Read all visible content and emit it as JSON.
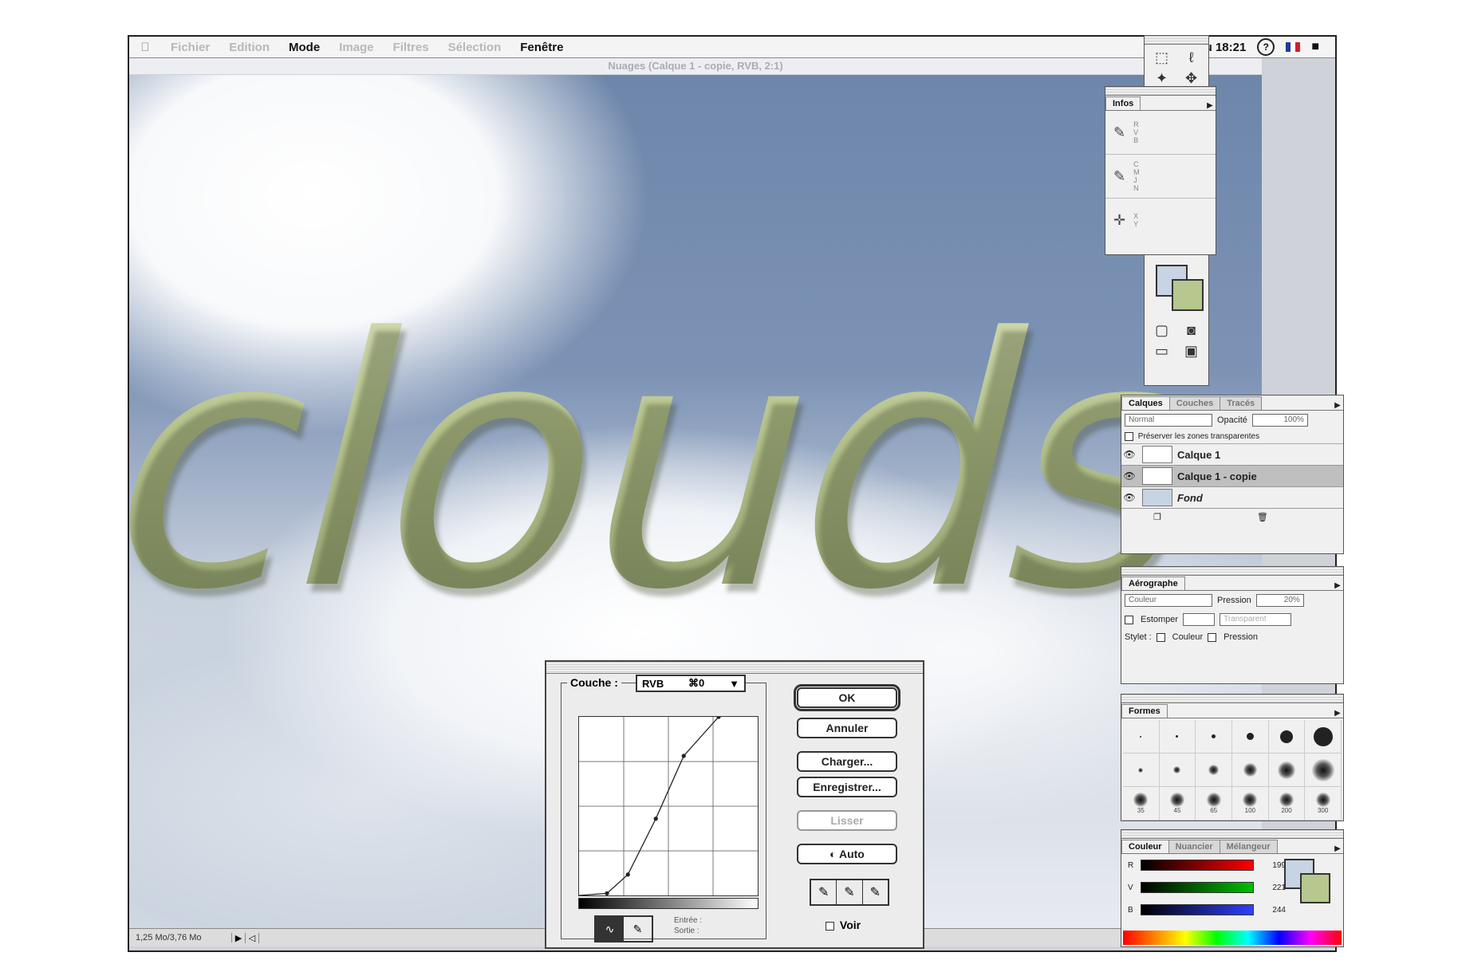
{
  "menubar": {
    "apple": "",
    "items": [
      "Fichier",
      "Edition",
      "Mode",
      "Image",
      "Filtres",
      "Sélection",
      "Fenêtre"
    ],
    "clock": "Jeu 18:21",
    "help": "?"
  },
  "document": {
    "title": "Nuages (Calque 1 - copie, RVB, 2:1)",
    "artwork_text": "clouds"
  },
  "statusbar": {
    "memory": "1,25 Mo/3,76 Mo"
  },
  "infos": {
    "tab": "Infos",
    "rows": [
      {
        "channels": "R\nV\nB"
      },
      {
        "channels": "C\nM\nJ\nN"
      },
      {
        "channels": "X\nY"
      }
    ]
  },
  "calques": {
    "tabs": [
      "Calques",
      "Couches",
      "Tracés"
    ],
    "mode": "Normal",
    "opacity_label": "Opacité",
    "opacity_value": "100%",
    "preserve_label": "Préserver les zones transparentes",
    "layers": [
      {
        "name": "Calque 1"
      },
      {
        "name": "Calque 1 - copie"
      },
      {
        "name": "Fond"
      }
    ]
  },
  "aerographe": {
    "tab": "Aérographe",
    "mode": "Couleur",
    "pressure_label": "Pression",
    "pressure_value": "20%",
    "fade_label": "Estomper",
    "fade_mode": "Transparent",
    "stylet_label": "Stylet :",
    "stylet_color": "Couleur",
    "stylet_pressure": "Pression"
  },
  "formes": {
    "tab": "Formes",
    "sizes": [
      "35",
      "45",
      "65",
      "100",
      "200",
      "300"
    ]
  },
  "couleur": {
    "tabs": [
      "Couleur",
      "Nuancier",
      "Mélangeur"
    ],
    "sliders": [
      {
        "label": "R",
        "value": "199"
      },
      {
        "label": "V",
        "value": "221"
      },
      {
        "label": "B",
        "value": "244"
      }
    ],
    "foreground": "#c6d4e3",
    "background": "#b6c88e"
  },
  "curves": {
    "couche_label": "Couche :",
    "couche_value": "RVB",
    "couche_shortcut": "⌘0",
    "buttons": {
      "ok": "OK",
      "cancel": "Annuler",
      "load": "Charger...",
      "save": "Enregistrer...",
      "smooth": "Lisser",
      "auto": "Auto"
    },
    "input_label": "Entrée :",
    "output_label": "Sortie :",
    "preview_label": "Voir",
    "curve_points": [
      [
        0,
        0
      ],
      [
        40,
        3
      ],
      [
        70,
        30
      ],
      [
        110,
        110
      ],
      [
        150,
        200
      ],
      [
        200,
        256
      ]
    ]
  }
}
